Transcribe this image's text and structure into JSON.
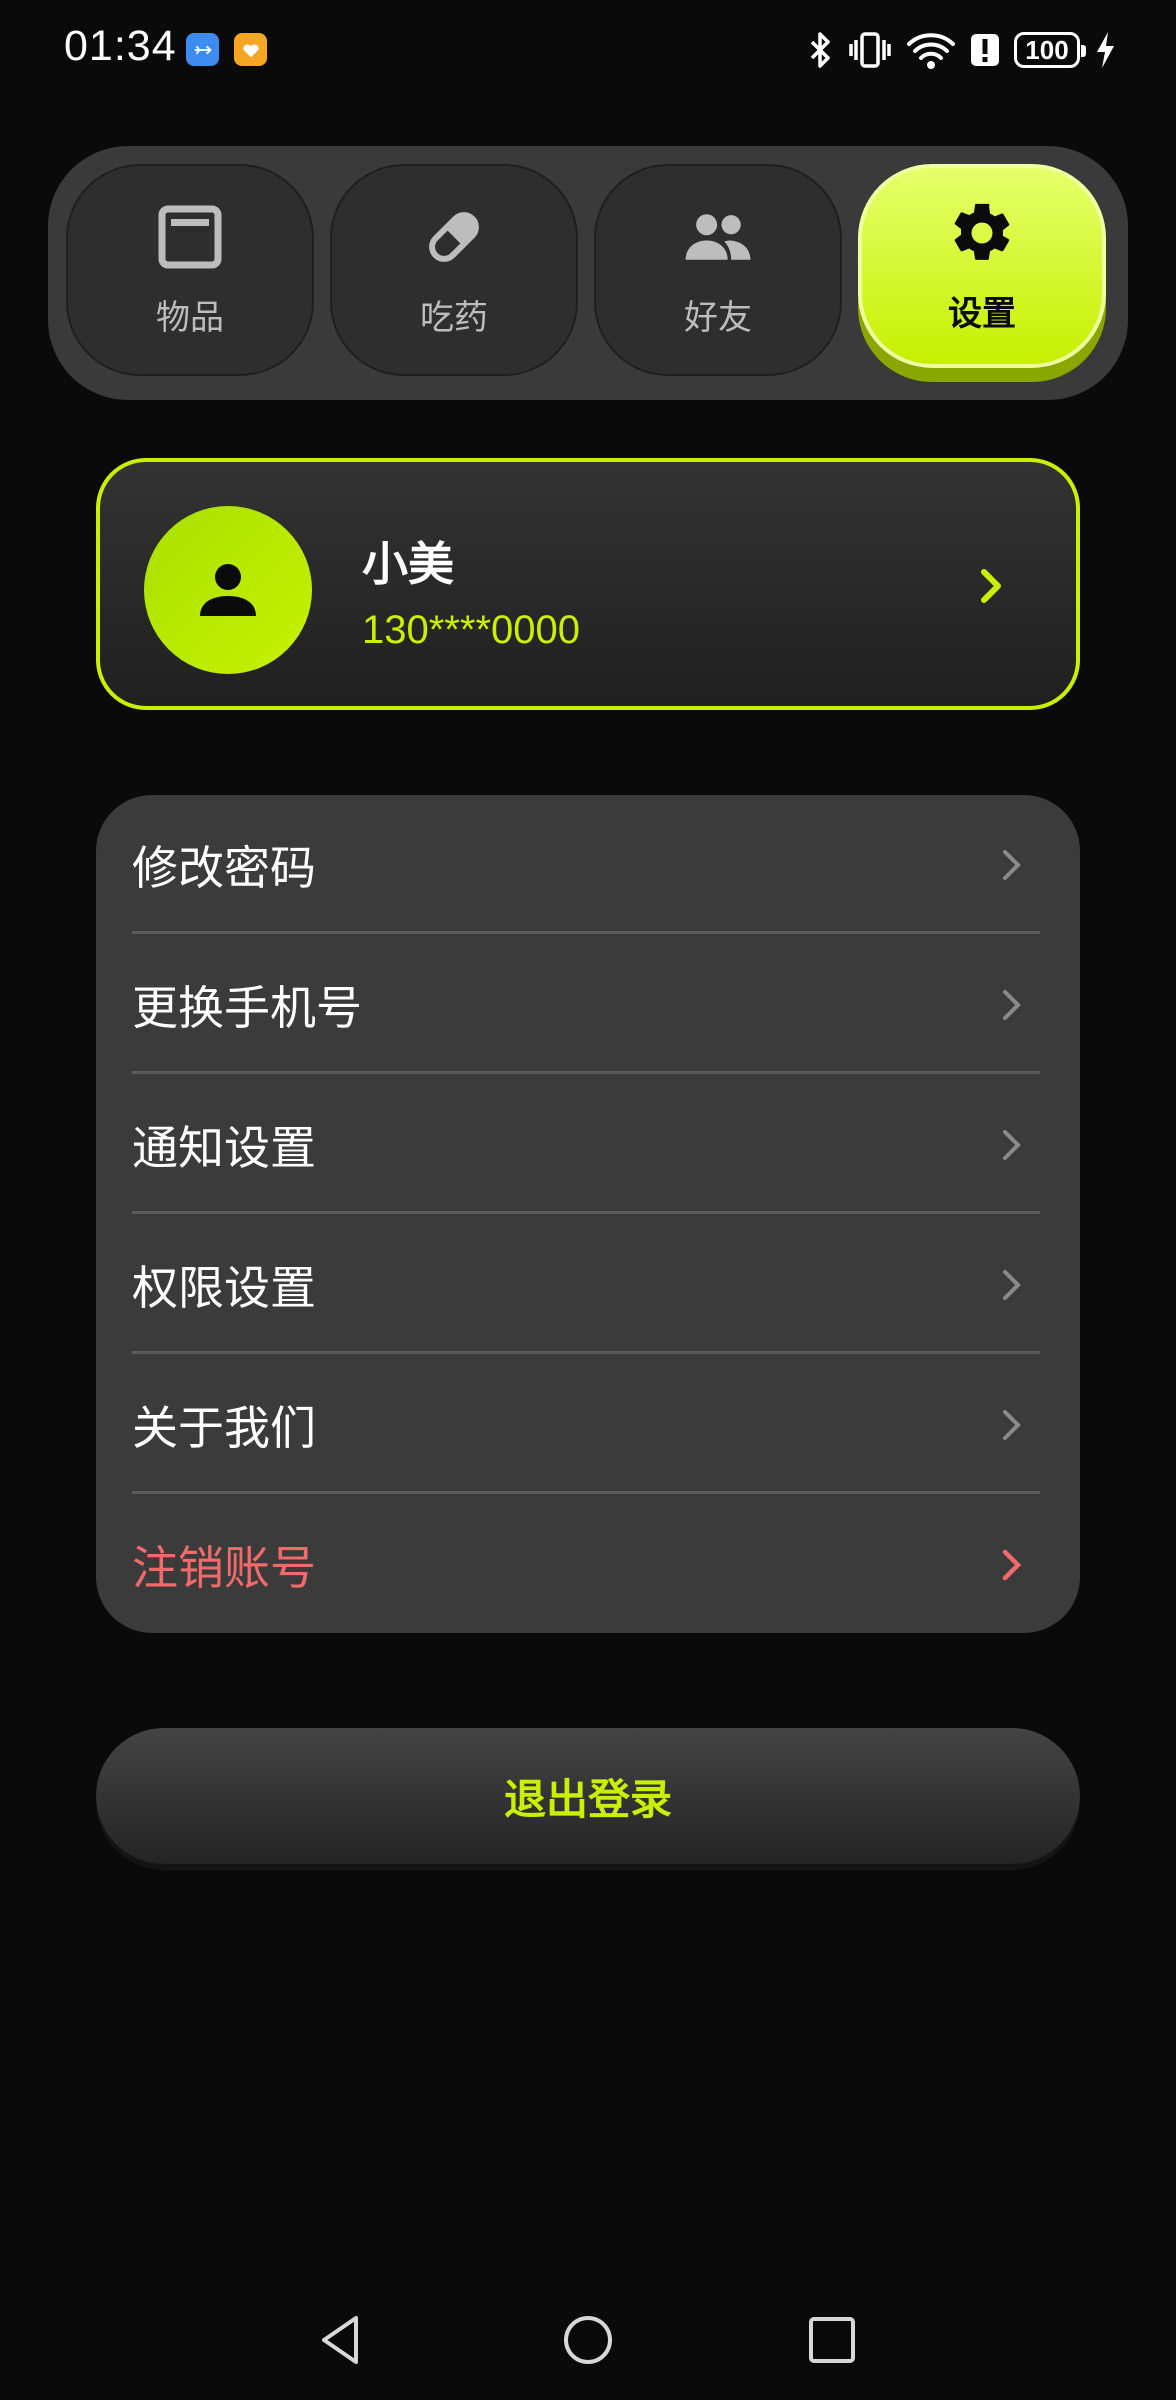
{
  "status_bar": {
    "time": "01:34",
    "battery": "100",
    "icons": [
      "usb-icon",
      "app-heart-icon",
      "bluetooth-icon",
      "vibrate-icon",
      "wifi-icon",
      "alert-icon",
      "battery-icon",
      "charging-icon"
    ]
  },
  "tabs": [
    {
      "label": "物品",
      "icon": "item-box-icon",
      "active": false
    },
    {
      "label": "吃药",
      "icon": "pill-icon",
      "active": false
    },
    {
      "label": "好友",
      "icon": "friends-icon",
      "active": false
    },
    {
      "label": "设置",
      "icon": "gear-icon",
      "active": true
    }
  ],
  "profile": {
    "name": "小美",
    "phone": "130****0000"
  },
  "menu": {
    "items": [
      {
        "label": "修改密码"
      },
      {
        "label": "更换手机号"
      },
      {
        "label": "通知设置"
      },
      {
        "label": "权限设置"
      },
      {
        "label": "关于我们"
      },
      {
        "label": "注销账号"
      }
    ]
  },
  "logout_label": "退出登录",
  "colors": {
    "accent": "#c8f000",
    "danger": "#f26a6a",
    "background": "#0a0a0a",
    "card": "#3b3b3b"
  },
  "nav": [
    "back-icon",
    "home-icon",
    "recents-icon"
  ]
}
